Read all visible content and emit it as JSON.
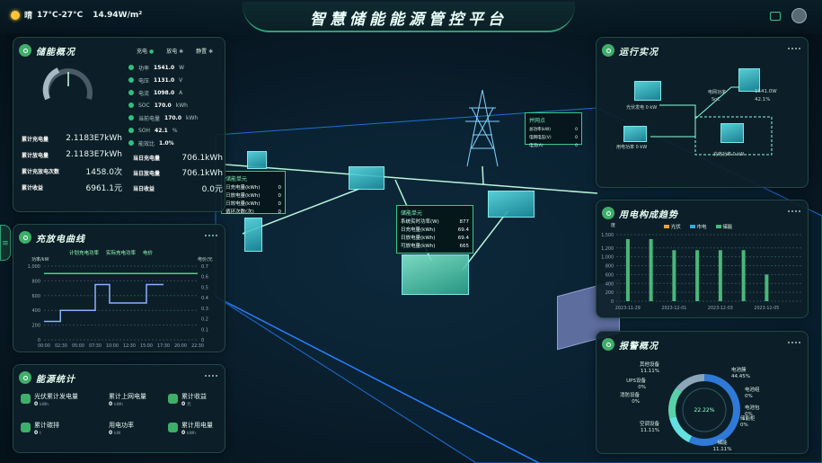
{
  "header": {
    "title": "智慧储能能源管控平台",
    "weather": "晴",
    "temp": "17°C-27°C",
    "irradiance": "14.94W/m²"
  },
  "storage": {
    "title": "储能概况",
    "status_tabs": [
      "充电",
      "放电",
      "静置"
    ],
    "metrics": [
      {
        "label": "功率",
        "value": "1541.0",
        "unit": "W"
      },
      {
        "label": "电压",
        "value": "1131.0",
        "unit": "V"
      },
      {
        "label": "电流",
        "value": "1098.0",
        "unit": "A"
      },
      {
        "label": "SOC",
        "value": "170.0",
        "unit": "kWh"
      },
      {
        "label": "当前电量",
        "value": "170.0",
        "unit": "kWh"
      },
      {
        "label": "SOH",
        "value": "42.1",
        "unit": "%"
      },
      {
        "label": "能效比",
        "value": "1.0%",
        "unit": ""
      }
    ],
    "totals": [
      {
        "label": "累计充电量",
        "value": "2.1183E7kWh"
      },
      {
        "label": "累计放电量",
        "value": "2.1183E7kWh"
      },
      {
        "label": "累计充放电次数",
        "value": "1458.0次"
      },
      {
        "label": "累计收益",
        "value": "6961.1元"
      }
    ],
    "today": [
      {
        "label": "当日充电量",
        "value": "706.1kWh"
      },
      {
        "label": "当日放电量",
        "value": "706.1kWh"
      },
      {
        "label": "当日收益",
        "value": "0.0元"
      }
    ]
  },
  "curve": {
    "title": "充放电曲线",
    "legend": [
      "计划充电功率",
      "实际充电功率",
      "电价"
    ],
    "y_left_label": "功率/kW",
    "y_right_label": "电价/元"
  },
  "energy": {
    "title": "能源统计",
    "items": [
      {
        "label": "光伏累计发电量",
        "value": "0",
        "unit": "kWh"
      },
      {
        "label": "累计上网电量",
        "value": "0",
        "unit": "kWh"
      },
      {
        "label": "累计收益",
        "value": "0",
        "unit": "元"
      },
      {
        "label": "累计碳排",
        "value": "0",
        "unit": "t"
      },
      {
        "label": "用电功率",
        "value": "0",
        "unit": "kW"
      },
      {
        "label": "累计用电量",
        "value": "0",
        "unit": "kWh"
      }
    ]
  },
  "ops": {
    "title": "运行实况",
    "pv_label": "光伏发电",
    "pv_value": "0 kW",
    "grid_label": "电网功率",
    "grid_value": "1541.0W",
    "soc_label": "SoC",
    "soc_value": "42.1%",
    "load_label": "用电功率",
    "load_value": "0 kW",
    "charge_label": "充电功率",
    "charge_value": "0 kW"
  },
  "trend": {
    "title": "用电构成趋势",
    "unit": "度",
    "legend": [
      "光伏",
      "市电",
      "储能"
    ]
  },
  "alarm": {
    "title": "报警概况",
    "center": "22.22%",
    "slices": [
      {
        "name": "其他设备",
        "pct": "11.11%",
        "color": "#8aa6b8"
      },
      {
        "name": "UPS设备",
        "pct": "0%",
        "color": "#3aa9d9"
      },
      {
        "name": "消防设备",
        "pct": "0%",
        "color": "#e0b04a"
      },
      {
        "name": "空调设备",
        "pct": "11.11%",
        "color": "#5ad0a8"
      },
      {
        "name": "储能",
        "pct": "11.11%",
        "color": "#63e0e0"
      },
      {
        "name": "电池簇",
        "pct": "44.45%",
        "color": "#2f79d8"
      },
      {
        "name": "电池组",
        "pct": "0%",
        "color": "#60a0ff"
      },
      {
        "name": "电池包",
        "pct": "0%",
        "color": "#9ec"
      },
      {
        "name": "储能柜",
        "pct": "0%",
        "color": "#7bd"
      }
    ]
  },
  "scene": {
    "popup1": {
      "title": "储能单元",
      "rows": [
        {
          "k": "日充电量(kWh)",
          "v": "0"
        },
        {
          "k": "日放电量(kWh)",
          "v": "0"
        },
        {
          "k": "日效电量(kWh)",
          "v": "0"
        },
        {
          "k": "循环次数(次)",
          "v": "0"
        }
      ]
    },
    "popup2": {
      "title": "储能单元",
      "rows": [
        {
          "k": "系统实时功率(W)",
          "v": "877"
        },
        {
          "k": "日充电量(kWh)",
          "v": "69.4"
        },
        {
          "k": "日放电量(kWh)",
          "v": "69.4"
        },
        {
          "k": "可放电量(kWh)",
          "v": "665"
        }
      ]
    },
    "popup3": {
      "title": "并网点",
      "rows": [
        {
          "k": "总功率(kW)",
          "v": "0"
        },
        {
          "k": "电网电压(V)",
          "v": "0"
        },
        {
          "k": "电流(A)",
          "v": "0"
        }
      ]
    }
  },
  "chart_data": [
    {
      "type": "line",
      "title": "充放电曲线",
      "x": [
        "00:00",
        "02:30",
        "05:00",
        "07:30",
        "10:00",
        "12:30",
        "15:00",
        "17:30",
        "20:00",
        "22:30"
      ],
      "ylabel": "功率/kW",
      "ylim": [
        0,
        1000
      ],
      "y2label": "电价/元",
      "y2lim": [
        0,
        0.7
      ],
      "series": [
        {
          "name": "计划充电功率",
          "color": "#3fd68a",
          "values": [
            900,
            900,
            900,
            900,
            900,
            900,
            900,
            900,
            900,
            900
          ]
        },
        {
          "name": "实际充电功率",
          "color": "#8ab0ff",
          "step_points": [
            [
              0,
              250
            ],
            [
              2.4,
              250
            ],
            [
              2.4,
              400
            ],
            [
              7.5,
              400
            ],
            [
              7.5,
              750
            ],
            [
              9.6,
              750
            ],
            [
              9.6,
              500
            ],
            [
              15,
              500
            ],
            [
              15,
              750
            ],
            [
              17.5,
              750
            ]
          ]
        },
        {
          "name": "电价",
          "color": "#c7b37a",
          "values": []
        }
      ]
    },
    {
      "type": "bar",
      "title": "用电构成趋势",
      "categories": [
        "2023-11-29",
        "2023-11-30",
        "2023-12-01",
        "2023-12-02",
        "2023-12-03",
        "2023-12-04",
        "2023-12-05",
        "2023-12-06"
      ],
      "ylabel": "度",
      "ylim": [
        0,
        1500
      ],
      "series": [
        {
          "name": "储能",
          "color": "#49b77a",
          "values": [
            1400,
            1400,
            1150,
            1150,
            1150,
            1150,
            600,
            0
          ]
        }
      ],
      "ticks_shown": [
        "2023-11-29",
        "2023-12-01",
        "2023-12-03",
        "2023-12-05"
      ]
    },
    {
      "type": "pie",
      "title": "报警概况",
      "labels": [
        "电池簇",
        "储能",
        "空调设备",
        "其他设备",
        "UPS设备",
        "消防设备",
        "电池组",
        "电池包",
        "储能柜"
      ],
      "values": [
        44.45,
        11.11,
        11.11,
        11.11,
        0,
        0,
        0,
        0,
        0
      ]
    }
  ]
}
